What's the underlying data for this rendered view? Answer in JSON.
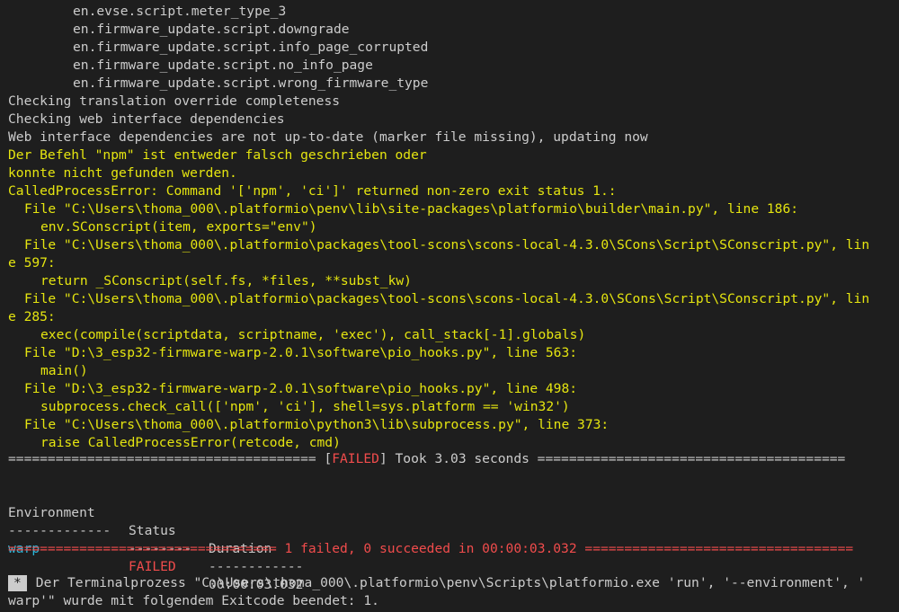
{
  "terminal": {
    "lines": [
      "en.evse.script.meter_type_3",
      "en.firmware_update.script.downgrade",
      "en.firmware_update.script.info_page_corrupted",
      "en.firmware_update.script.no_info_page",
      "en.firmware_update.script.wrong_firmware_type",
      "Checking translation override completeness",
      "Checking web interface dependencies",
      "Web interface dependencies are not up-to-date (marker file missing), updating now",
      "Der Befehl \"npm\" ist entweder falsch geschrieben oder",
      "konnte nicht gefunden werden.",
      "CalledProcessError: Command '['npm', 'ci']' returned non-zero exit status 1.:",
      "File \"C:\\Users\\thoma_000\\.platformio\\penv\\lib\\site-packages\\platformio\\builder\\main.py\", line 186:",
      "env.SConscript(item, exports=\"env\")",
      "File \"C:\\Users\\thoma_000\\.platformio\\packages\\tool-scons\\scons-local-4.3.0\\SCons\\Script\\SConscript.py\", lin",
      "e 597:",
      "return _SConscript(self.fs, *files, **subst_kw)",
      "File \"C:\\Users\\thoma_000\\.platformio\\packages\\tool-scons\\scons-local-4.3.0\\SCons\\Script\\SConscript.py\", lin",
      "e 285:",
      "exec(compile(scriptdata, scriptname, 'exec'), call_stack[-1].globals)",
      "File \"D:\\3_esp32-firmware-warp-2.0.1\\software\\pio_hooks.py\", line 563:",
      "main()",
      "File \"D:\\3_esp32-firmware-warp-2.0.1\\software\\pio_hooks.py\", line 498:",
      "subprocess.check_call(['npm', 'ci'], shell=sys.platform == 'win32')",
      "File \"C:\\Users\\thoma_000\\.platformio\\python3\\lib\\subprocess.py\", line 373:",
      "raise CalledProcessError(retcode, cmd)"
    ],
    "summary": {
      "sep_left": "======================================= [",
      "failed": "FAILED",
      "sep_right": "] Took 3.03 seconds =======================================",
      "table_headers": [
        "Environment",
        "Status",
        "Duration"
      ],
      "table_dashes": [
        "-------------",
        "--------",
        "------------"
      ],
      "row": {
        "env": "warp",
        "status": "FAILED",
        "duration": "00:00:03.032"
      },
      "result_left": "================================== ",
      "result_text": "1 failed, 0 succeeded in 00:00:03.032",
      "result_right": " =================================="
    },
    "footer": {
      "badge": "*",
      "line1": "Der Terminalprozess \"C:\\Users\\thoma_000\\.platformio\\penv\\Scripts\\platformio.exe 'run', '--environment', '",
      "line2": "warp'\" wurde mit folgendem Exitcode beendet: 1."
    }
  },
  "colors": {
    "background": "#1e1e1e",
    "text": "#cccccc",
    "yellow": "#e5e510",
    "red": "#f14c4c",
    "cyan": "#29b8db"
  }
}
